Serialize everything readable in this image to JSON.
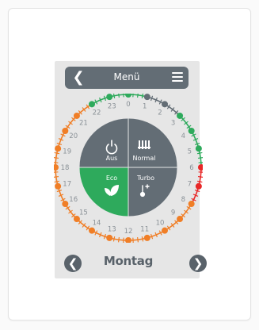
{
  "header": {
    "title": "Menü"
  },
  "hours": [
    "0",
    "1",
    "2",
    "3",
    "4",
    "5",
    "6",
    "7",
    "8",
    "9",
    "10",
    "11",
    "12",
    "13",
    "14",
    "15",
    "16",
    "17",
    "18",
    "19",
    "20",
    "21",
    "22",
    "23"
  ],
  "hour_states": [
    "green",
    "gray",
    "gray",
    "green",
    "green",
    "green",
    "red",
    "red",
    "orange",
    "orange",
    "orange",
    "orange",
    "orange",
    "orange",
    "orange",
    "orange",
    "orange",
    "orange",
    "orange",
    "orange",
    "orange",
    "orange",
    "green",
    "green"
  ],
  "modes": {
    "aus": {
      "label": "Aus"
    },
    "normal": {
      "label": "Normal"
    },
    "eco": {
      "label": "Eco"
    },
    "turbo": {
      "label": "Turbo"
    }
  },
  "day": {
    "label": "Montag"
  },
  "colors": {
    "green": "#2eaa5c",
    "gray": "#636d75",
    "red": "#e82727",
    "orange": "#f07e26",
    "mode_dark": "#636d75",
    "mode_eco": "#2eaa5c"
  }
}
